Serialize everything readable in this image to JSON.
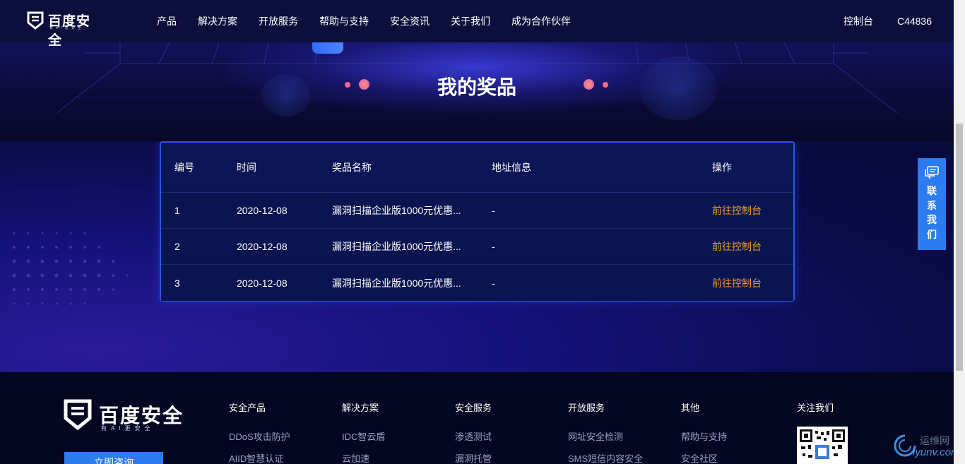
{
  "brand": {
    "name": "百度安全",
    "tagline": "有AI更安全"
  },
  "nav": {
    "items": [
      {
        "label": "产品"
      },
      {
        "label": "解决方案"
      },
      {
        "label": "开放服务"
      },
      {
        "label": "帮助与支持"
      },
      {
        "label": "安全资讯"
      },
      {
        "label": "关于我们"
      },
      {
        "label": "成为合作伙伴"
      }
    ],
    "console": "控制台",
    "user": "C44836"
  },
  "page": {
    "title": "我的奖品"
  },
  "table": {
    "headers": {
      "id": "编号",
      "time": "时间",
      "name": "奖品名称",
      "address": "地址信息",
      "action": "操作"
    },
    "rows": [
      {
        "id": "1",
        "time": "2020-12-08",
        "name": "漏洞扫描企业版1000元优惠...",
        "address": "-",
        "action": "前往控制台"
      },
      {
        "id": "2",
        "time": "2020-12-08",
        "name": "漏洞扫描企业版1000元优惠...",
        "address": "-",
        "action": "前往控制台"
      },
      {
        "id": "3",
        "time": "2020-12-08",
        "name": "漏洞扫描企业版1000元优惠...",
        "address": "-",
        "action": "前往控制台"
      }
    ]
  },
  "contact": {
    "label": "联系我们",
    "icon": "chat-bubble-icon"
  },
  "footer": {
    "consult": "立即咨询",
    "columns": [
      {
        "title": "安全产品",
        "links": [
          "DDoS攻击防护",
          "AIID智慧认证"
        ]
      },
      {
        "title": "解决方案",
        "links": [
          "IDC智云盾",
          "云加速"
        ]
      },
      {
        "title": "安全服务",
        "links": [
          "渗透测试",
          "漏洞托管"
        ]
      },
      {
        "title": "开放服务",
        "links": [
          "网址安全检测",
          "SMS短信内容安全"
        ]
      },
      {
        "title": "其他",
        "links": [
          "帮助与支持",
          "安全社区"
        ]
      },
      {
        "title": "关注我们",
        "links": []
      }
    ]
  },
  "watermark": {
    "top": "运维网",
    "bottom": "iyunv.com"
  },
  "colors": {
    "accent": "#2c7bef",
    "link": "#f39a2a",
    "header_bg": "#0c0f3c",
    "footer_bg": "#050722"
  }
}
